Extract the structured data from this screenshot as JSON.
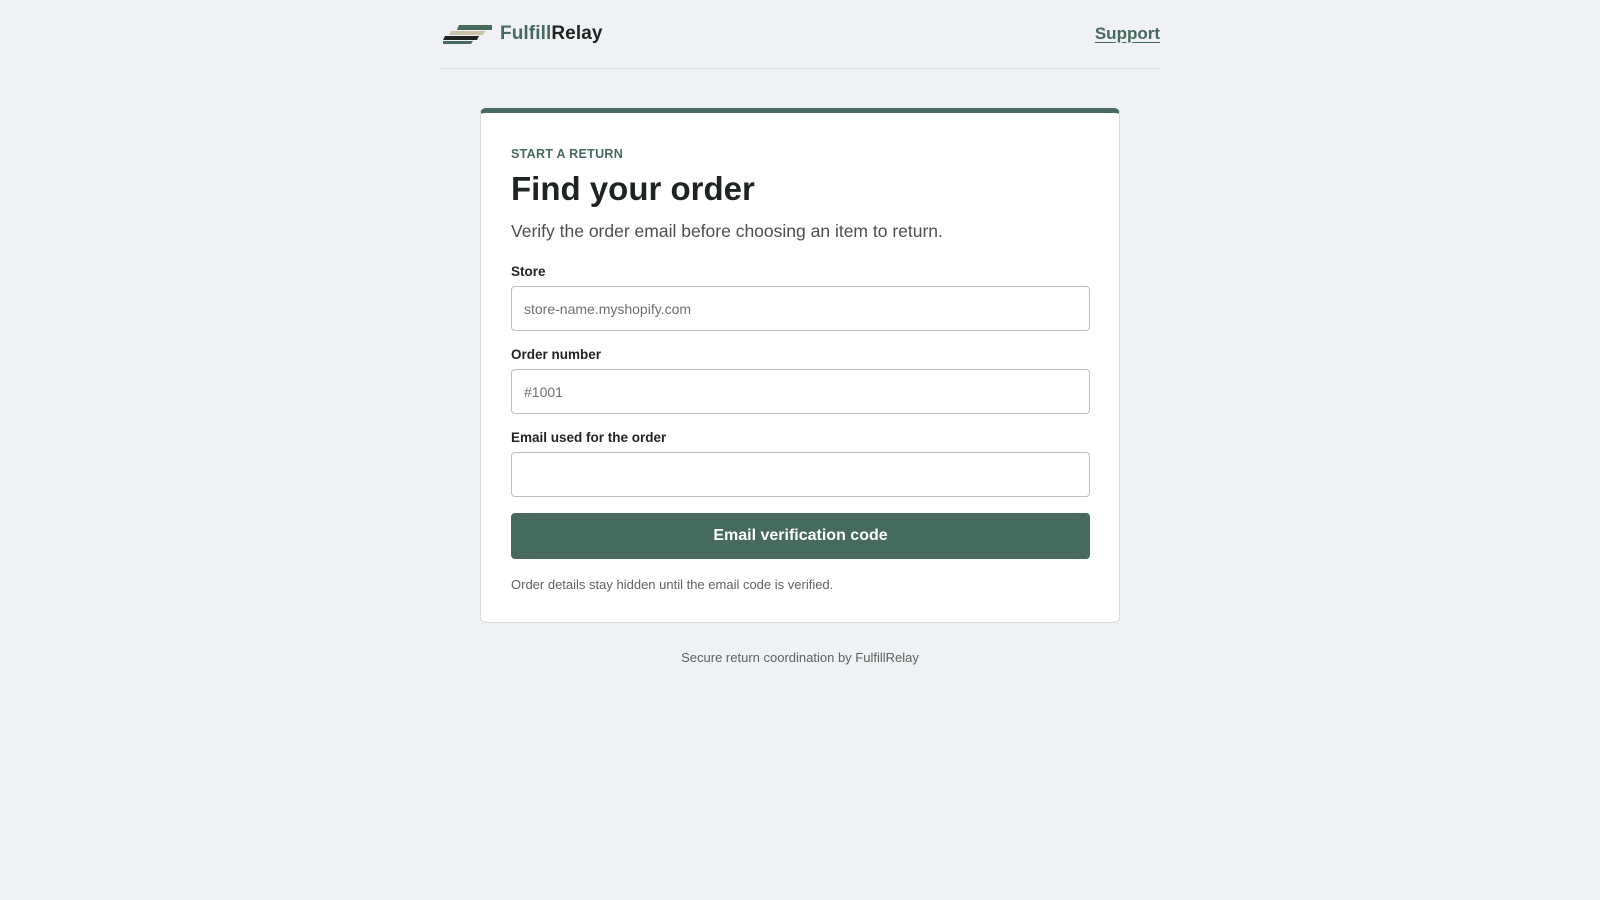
{
  "header": {
    "brand_part1": "Fulfill",
    "brand_part2": "Relay",
    "logo_icon": "stacked-stripes-logo-icon",
    "support_link": "Support"
  },
  "card": {
    "eyebrow": "START A RETURN",
    "title": "Find your order",
    "subtitle": "Verify the order email before choosing an item to return.",
    "fields": {
      "store": {
        "label": "Store",
        "value": "",
        "placeholder": "store-name.myshopify.com"
      },
      "order_number": {
        "label": "Order number",
        "value": "",
        "placeholder": "#1001"
      },
      "email": {
        "label": "Email used for the order",
        "value": "",
        "placeholder": ""
      }
    },
    "submit_label": "Email verification code",
    "hint": "Order details stay hidden until the email code is verified."
  },
  "footer": {
    "text": "Secure return coordination by FulfillRelay"
  },
  "colors": {
    "accent": "#466a5d",
    "background": "#eff1f4",
    "card": "#ffffff",
    "text": "#1f2421"
  }
}
